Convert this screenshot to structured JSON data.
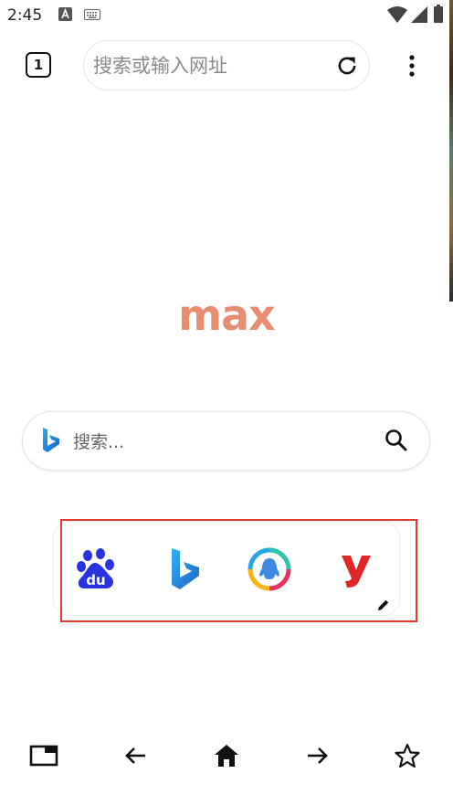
{
  "status_bar": {
    "time": "2:45"
  },
  "toolbar": {
    "tab_count": "1",
    "url_placeholder": "搜索或输入网址"
  },
  "logo": {
    "text": "max"
  },
  "search": {
    "placeholder": "搜索..."
  },
  "shortcuts": [
    {
      "icon": "baidu-icon"
    },
    {
      "icon": "bing-icon"
    },
    {
      "icon": "qq-icon"
    },
    {
      "icon": "y-app-icon"
    }
  ],
  "bottom_nav": [
    {
      "icon": "tabs-icon"
    },
    {
      "icon": "back-arrow-icon"
    },
    {
      "icon": "home-icon"
    },
    {
      "icon": "forward-arrow-icon"
    },
    {
      "icon": "star-icon"
    }
  ],
  "colors": {
    "logo": "#e78d72",
    "highlight": "#e33a2f",
    "baidu_blue": "#2932e1",
    "bing_blue": "#1d80d8",
    "y_red": "#e12626"
  }
}
